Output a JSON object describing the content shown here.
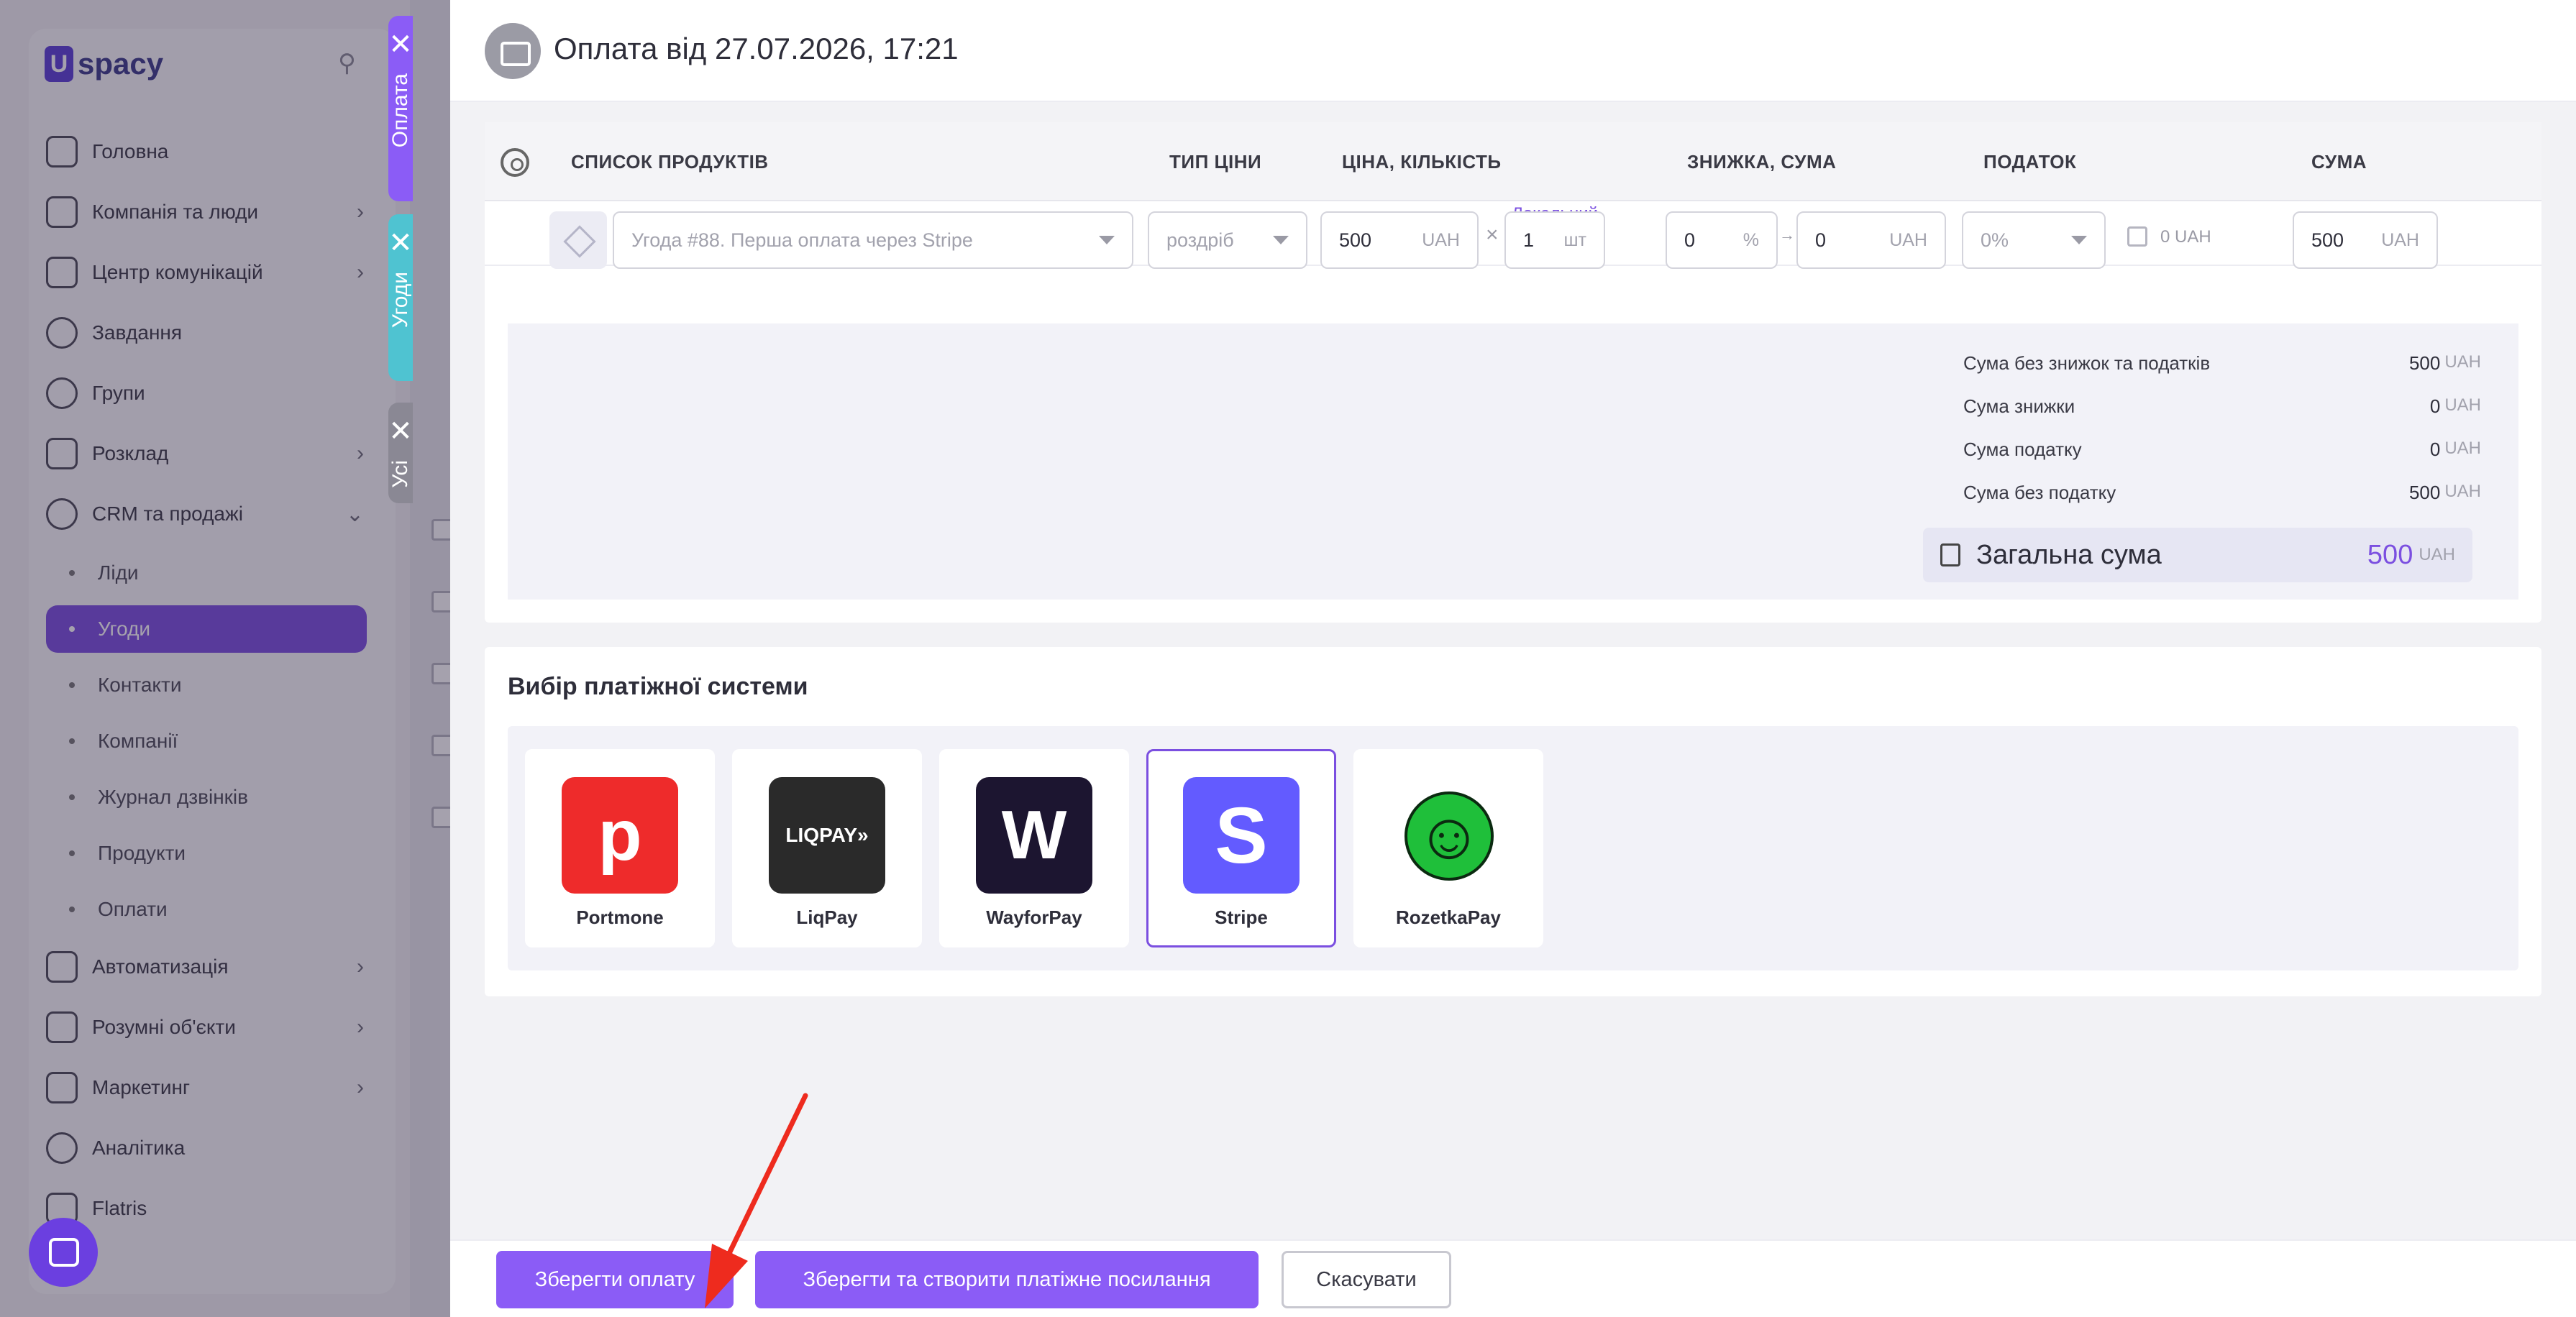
{
  "sidebar": {
    "logo_mark": "U",
    "logo_text": "spacy",
    "items": [
      {
        "label": "Головна"
      },
      {
        "label": "Компанія та люди"
      },
      {
        "label": "Центр комунікацій"
      },
      {
        "label": "Завдання"
      },
      {
        "label": "Групи"
      },
      {
        "label": "Розклад"
      },
      {
        "label": "CRM та продажі"
      }
    ],
    "crm_sub": [
      {
        "label": "Ліди"
      },
      {
        "label": "Угоди"
      },
      {
        "label": "Контакти"
      },
      {
        "label": "Компанії"
      },
      {
        "label": "Журнал дзвінків"
      },
      {
        "label": "Продукти"
      },
      {
        "label": "Оплати"
      }
    ],
    "items_after": [
      {
        "label": "Автоматизація"
      },
      {
        "label": "Розумні об'єкти"
      },
      {
        "label": "Маркетинг"
      },
      {
        "label": "Аналітика"
      },
      {
        "label": "Flatris"
      }
    ]
  },
  "vtabs": {
    "payment": "Оплата",
    "deals": "Угоди",
    "all": "Усі",
    "close_glyph": "✕"
  },
  "header": {
    "title": "Оплата від 27.07.2026, 17:21"
  },
  "products": {
    "columns": {
      "list": "СПИСОК ПРОДУКТІВ",
      "price_type": "ТИП ЦІНИ",
      "price_qty": "ЦІНА, КІЛЬКІСТЬ",
      "discount": "ЗНИЖКА, СУМА",
      "tax": "ПОДАТОК",
      "sum": "СУМА"
    },
    "row": {
      "product_name": "Угода #88. Перша оплата через Stripe",
      "badge": "Локальний",
      "price_type": "роздріб",
      "price": "500",
      "price_unit": "UAH",
      "times": "×",
      "qty": "1",
      "qty_unit": "шт",
      "discount_pct": "0",
      "pct_unit": "%",
      "arrow": "→",
      "discount_amt": "0",
      "discount_unit": "UAH",
      "tax": "0%",
      "tax_amount": "0 UAH",
      "sum": "500",
      "sum_unit": "UAH"
    }
  },
  "summary": {
    "rows": [
      {
        "label": "Сума без знижок та податків",
        "value": "500",
        "unit": "UAH"
      },
      {
        "label": "Сума знижки",
        "value": "0",
        "unit": "UAH"
      },
      {
        "label": "Сума податку",
        "value": "0",
        "unit": "UAH"
      },
      {
        "label": "Сума без податку",
        "value": "500",
        "unit": "UAH"
      }
    ],
    "total_label": "Загальна сума",
    "total_value": "500",
    "total_unit": "UAH"
  },
  "payment": {
    "title": "Вибір платіжної системи",
    "systems": [
      {
        "name": "Portmone",
        "glyph": "p",
        "color": "#ee2b2b"
      },
      {
        "name": "LiqPay",
        "glyph": "LIQPAY»",
        "color": "#2a2a2a"
      },
      {
        "name": "WayforPay",
        "glyph": "W",
        "color": "#1c1530"
      },
      {
        "name": "Stripe",
        "glyph": "S",
        "color": "#635bff",
        "selected": true
      },
      {
        "name": "RozetkaPay",
        "glyph": "☺",
        "color": "#1fbf3a"
      }
    ]
  },
  "actions": {
    "save": "Зберегти оплату",
    "save_link": "Зберегти та створити платіжне посилання",
    "cancel": "Скасувати"
  },
  "colors": {
    "accent": "#8b5cf6",
    "stripe": "#635bff",
    "annotation_arrow": "#ee2b1e"
  }
}
